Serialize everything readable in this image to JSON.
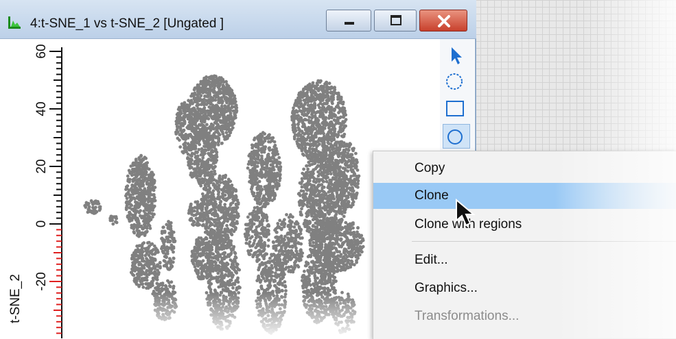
{
  "window": {
    "title": "4:t-SNE_1 vs t-SNE_2 [Ungated ]",
    "title_icon": "histogram-app-icon",
    "controls": [
      "minimize",
      "maximize",
      "close"
    ]
  },
  "plot": {
    "y_axis_label": "t-SNE_2",
    "y_tick_labels": [
      "60",
      "40",
      "20",
      "0",
      "-20"
    ],
    "dot_color": "#808080"
  },
  "toolbox": {
    "tools": [
      "pointer-tool",
      "ellipse-region-tool",
      "rectangle-region-tool",
      "circle-region-tool"
    ],
    "selected": "circle-region-tool"
  },
  "context_menu": {
    "items": [
      {
        "label": "Copy",
        "state": "normal"
      },
      {
        "label": "Clone",
        "state": "hover"
      },
      {
        "label": "Clone with regions",
        "state": "normal"
      },
      {
        "label": "Edit...",
        "state": "normal"
      },
      {
        "label": "Graphics...",
        "state": "normal"
      },
      {
        "label": "Transformations...",
        "state": "disabled"
      }
    ]
  },
  "colors": {
    "titlebar": "#c8d8ec",
    "close_button": "#c8402c",
    "menu_hover": "#99c9f5",
    "axis_red": "#e02020"
  }
}
